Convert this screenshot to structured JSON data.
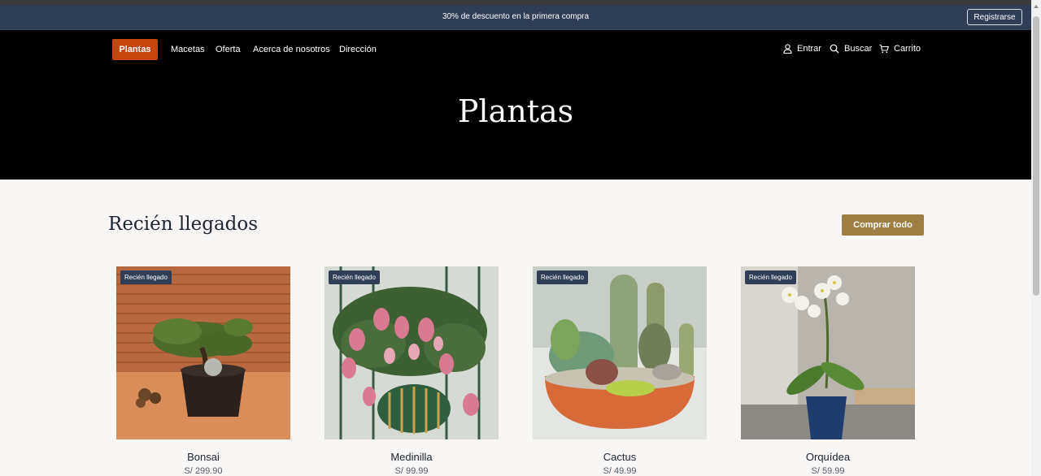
{
  "promo": {
    "text": "30% de descuento en la primera compra",
    "register_label": "Registrarse"
  },
  "nav": {
    "items": [
      {
        "label": "Plantas"
      },
      {
        "label": "Macetas"
      },
      {
        "label": "Oferta"
      },
      {
        "label": "Acerca de nosotros"
      },
      {
        "label": "Dirección"
      }
    ],
    "utilities": [
      {
        "label": "Entrar",
        "icon": "user-icon"
      },
      {
        "label": "Buscar",
        "icon": "search-icon"
      },
      {
        "label": "Carrito",
        "icon": "cart-icon"
      }
    ]
  },
  "hero": {
    "title": "Plantas"
  },
  "section": {
    "title": "Recién llegados",
    "shop_all_label": "Comprar todo"
  },
  "products": [
    {
      "name": "Bonsai",
      "price": "S/ 299.90",
      "badge": "Recién llegado"
    },
    {
      "name": "Medinilla",
      "price": "S/ 99.99",
      "badge": "Recién llegado"
    },
    {
      "name": "Cactus",
      "price": "S/ 49.99",
      "badge": "Recién llegado"
    },
    {
      "name": "Orquídea",
      "price": "S/ 59.99",
      "badge": "Recién llegado"
    }
  ],
  "colors": {
    "promo_bg": "#2f3e55",
    "accent_orange": "#c8440e",
    "accent_gold": "#a07d42",
    "hero_bg": "#000000"
  }
}
